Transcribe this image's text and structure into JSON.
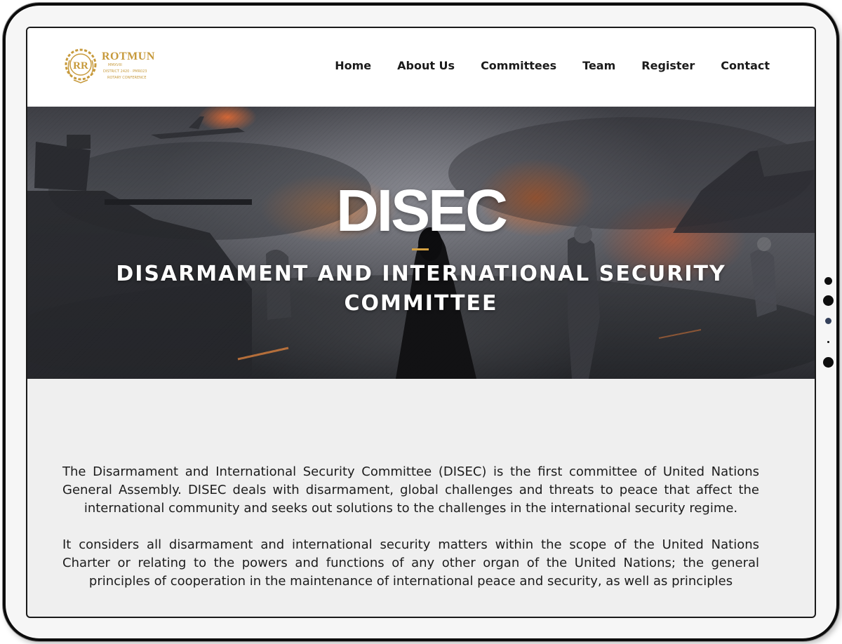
{
  "site": {
    "logo": {
      "name": "ROTMUN",
      "tagline_lines": [
        "MMXVIII",
        "DISTRICT 2420 · PMR023",
        "ROTARY CONFERENCE"
      ]
    },
    "nav": [
      {
        "label": "Home"
      },
      {
        "label": "About Us"
      },
      {
        "label": "Committees"
      },
      {
        "label": "Team"
      },
      {
        "label": "Register"
      },
      {
        "label": "Contact"
      }
    ]
  },
  "hero": {
    "title": "DISEC",
    "subtitle": "DISARMAMENT AND INTERNATIONAL SECURITY COMMITTEE"
  },
  "content": {
    "paragraphs": [
      "The Disarmament and International Security Committee (DISEC) is the first committee of United Nations General Assembly. DISEC deals with disarmament, global challenges and threats to peace that affect the international community and seeks out solutions to the challenges in the international security regime.",
      "It considers all disarmament and international security matters within the scope of the United Nations Charter or relating to the powers and functions of any other organ of the United Nations; the general principles of cooperation in the maintenance of international peace and security, as well as principles"
    ]
  },
  "colors": {
    "accent_gold": "#c79a3c",
    "hero_rule": "#d4a041",
    "nav_text": "#1b1b1b",
    "body_text": "#1c1c1c",
    "content_background": "#efefef"
  }
}
